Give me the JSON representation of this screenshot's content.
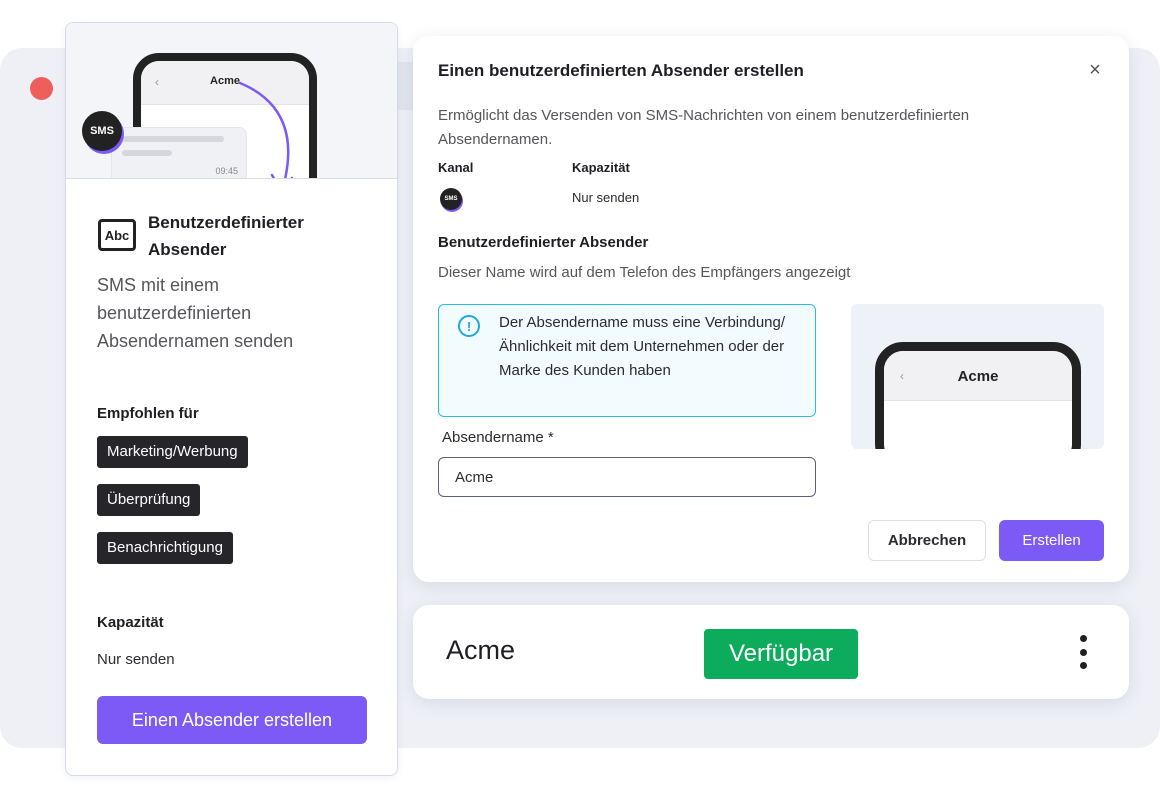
{
  "left_card": {
    "preview_phone_name": "Acme",
    "preview_back": "‹",
    "preview_time": "09:45",
    "sms_badge": "SMS",
    "abc_icon_label": "Abc",
    "title": "Benutzerdefinierter Absender",
    "description": "SMS mit einem benutzerdefinierten Absendernamen senden",
    "recommended_heading": "Empfohlen für",
    "tags": [
      "Marketing/Werbung",
      "Überprüfung",
      "Benachrichtigung"
    ],
    "capacity_heading": "Kapazität",
    "capacity_value": "Nur senden",
    "cta_label": "Einen Absender erstellen"
  },
  "dialog": {
    "title": "Einen benutzerdefinierten Absender erstellen",
    "close_icon": "×",
    "description": "Ermöglicht das Versenden von SMS-Nachrichten von einem benutzerdefinierten Absendernamen.",
    "channel_label": "Kanal",
    "capacity_label": "Kapazität",
    "channel_icon_label": "SMS",
    "capacity_value": "Nur senden",
    "section_heading": "Benutzerdefinierter Absender",
    "section_sub": "Dieser Name wird auf dem Telefon des Empfängers angezeigt",
    "info_icon": "!",
    "info_text": "Der Absendername muss eine Verbindung/Ähnlichkeit mit dem Unternehmen oder der Marke des Kunden haben",
    "field_label": "Absendername *",
    "field_value": "Acme",
    "preview_back": "‹",
    "preview_name": "Acme",
    "cancel_label": "Abbrechen",
    "create_label": "Erstellen"
  },
  "sender_row": {
    "name": "Acme",
    "status": "Verfügbar"
  },
  "colors": {
    "accent": "#7b5af5",
    "success": "#0cac5c",
    "info": "#2bbbe6",
    "window_dot": "#ee5f5b"
  }
}
